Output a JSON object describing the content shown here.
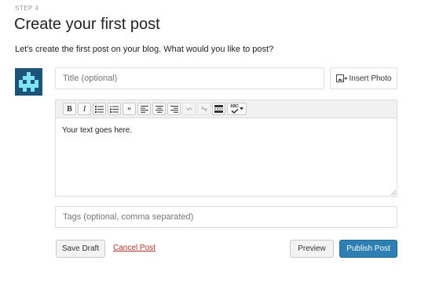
{
  "header": {
    "step": "STEP 4",
    "title": "Create your first post",
    "intro": "Let's create the first post on your blog. What would you like to post?"
  },
  "form": {
    "title_placeholder": "Title (optional)",
    "insert_photo_label": "Insert Photo",
    "editor_text": "Your text goes here.",
    "tags_placeholder": "Tags (optional, comma separated)"
  },
  "toolbar": {
    "bold": "B",
    "italic": "I",
    "blockquote": "“",
    "spell": "ABC"
  },
  "actions": {
    "save_draft": "Save Draft",
    "cancel_post": "Cancel Post",
    "preview": "Preview",
    "publish": "Publish Post"
  },
  "colors": {
    "accent": "#2e7fb2",
    "cancel_link": "#b0312b",
    "avatar_bg": "#1b5478",
    "avatar_fg": "#7ee3f3"
  }
}
